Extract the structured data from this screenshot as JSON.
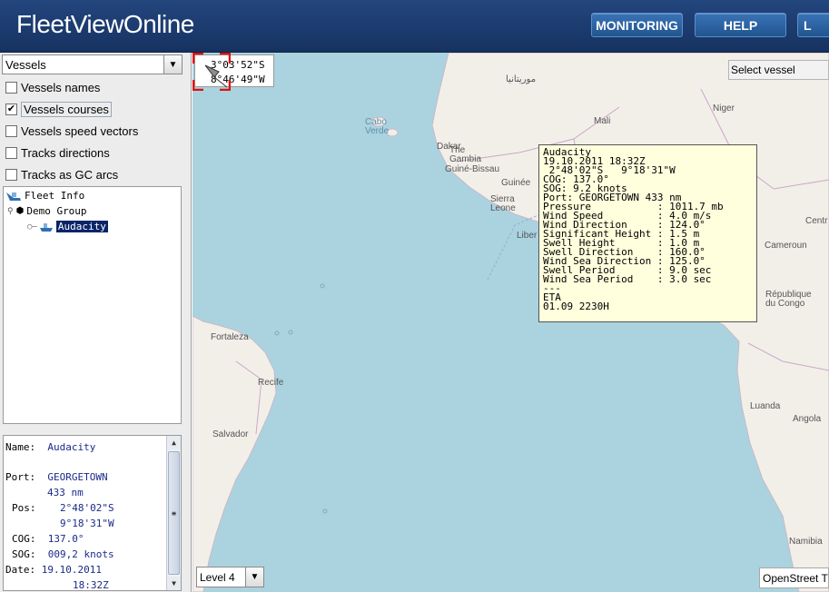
{
  "header": {
    "logo": "FleetViewOnline",
    "nav": [
      {
        "label": "MONITORING"
      },
      {
        "label": "HELP"
      },
      {
        "label": "L"
      }
    ]
  },
  "left_panel": {
    "layer_select": {
      "value": "Vessels"
    },
    "options": [
      {
        "label": "Vessels names",
        "checked": false
      },
      {
        "label": "Vessels courses",
        "checked": true
      },
      {
        "label": "Vessels speed vectors",
        "checked": false
      },
      {
        "label": "Tracks directions",
        "checked": false
      },
      {
        "label": "Tracks as GC arcs",
        "checked": false
      }
    ],
    "tree": {
      "root": "Fleet Info",
      "group": "Demo Group",
      "vessel": "Audacity"
    },
    "info": {
      "name_key": "Name:",
      "name_val": "Audacity",
      "port_key": "Port:",
      "port_val": "GEORGETOWN",
      "dist_val": "433 nm",
      "pos_key": "Pos:",
      "pos_lat": "2°48'02\"S",
      "pos_lon": "9°18'31\"W",
      "cog_key": "COG:",
      "cog_val": "137.0°",
      "sog_key": "SOG:",
      "sog_val": "009,2 knots",
      "date_key": "Date:",
      "date_val": "19.10.2011",
      "time_val": "18:32Z"
    }
  },
  "map": {
    "cursor_lat": "3°03'52\"S",
    "cursor_lon": "8°46'49\"W",
    "select_vessel": "Select vessel",
    "zoom_level": "Level 4",
    "credit": "OpenStreet T",
    "ocean_color": "#aad3df",
    "land_color": "#f2efe9",
    "labels": {
      "mauritania": "موريتانيا",
      "mali": "Mali",
      "niger": "Niger",
      "cabo_verde": "Cabo\nVerde",
      "dakar": "Dakar",
      "gambia": "The\nGambia",
      "guinea_bissau": "Guiné-Bissau",
      "guinee": "Guinée",
      "sierra_leone": "Sierra\nLeone",
      "liberia": "Liber",
      "cameroun": "Cameroun",
      "centr": "Centr",
      "congo": "République\ndu Congo",
      "luanda": "Luanda",
      "angola": "Angola",
      "namibia": "Namibia",
      "fortaleza": "Fortaleza",
      "recife": "Recife",
      "salvador": "Salvador"
    },
    "popup": {
      "lines": [
        "Audacity",
        "19.10.2011 18:32Z",
        " 2°48'02\"S   9°18'31\"W",
        "COG: 137.0°",
        "SOG: 9.2 knots",
        "Port: GEORGETOWN 433 nm",
        "Pressure           : 1011.7 mb",
        "Wind Speed         : 4.0 m/s",
        "Wind Direction     : 124.0°",
        "Significant Height : 1.5 m",
        "Swell Height       : 1.0 m",
        "Swell Direction    : 160.0°",
        "Wind Sea Direction : 125.0°",
        "Swell Period       : 9.0 sec",
        "Wind Sea Period    : 3.0 sec",
        "---",
        "ETA",
        "01.09 2230H"
      ]
    },
    "marker_color": "#dd1111"
  }
}
